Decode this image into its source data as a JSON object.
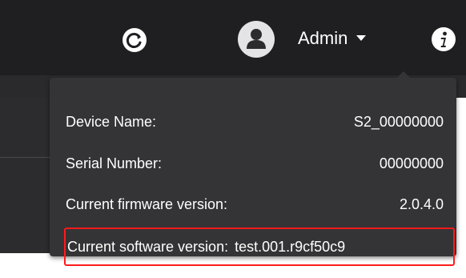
{
  "header": {
    "user_name": "Admin",
    "icons": {
      "sync": "sync-icon",
      "avatar": "user-avatar-icon",
      "caret": "caret-down-icon",
      "info": "info-icon"
    }
  },
  "device_info_popup": {
    "rows": [
      {
        "label": "Device Name:",
        "value": "S2_00000000"
      },
      {
        "label": "Serial Number:",
        "value": "00000000"
      },
      {
        "label": "Current firmware version:",
        "value": "2.0.4.0"
      },
      {
        "label": "Current software version:",
        "value": "test.001.r9cf50c9"
      }
    ]
  },
  "colors": {
    "header_bg": "#1f1f22",
    "popup_bg": "#343436",
    "text": "#ffffff",
    "highlight": "#ff1a1a"
  }
}
